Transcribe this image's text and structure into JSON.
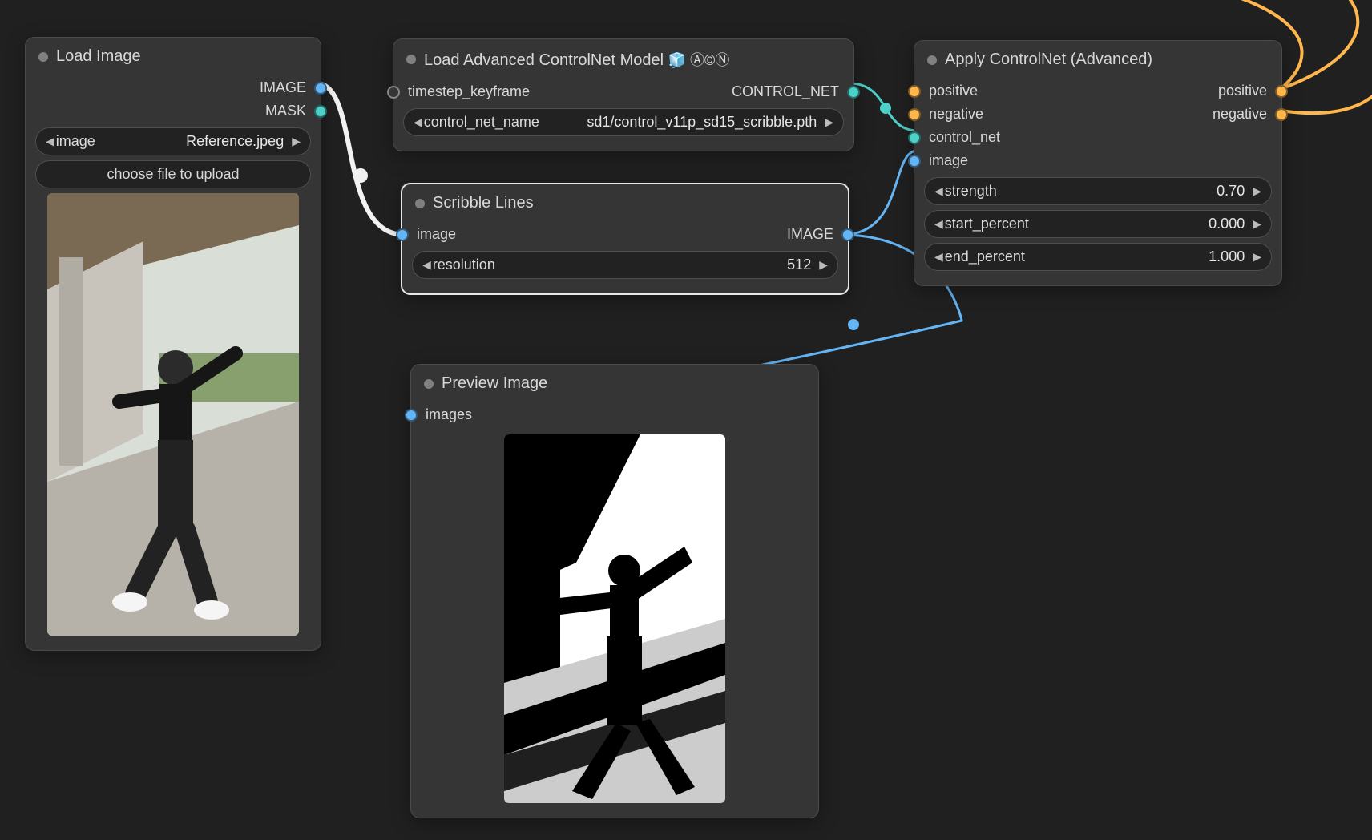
{
  "nodes": {
    "loadImage": {
      "title": "Load Image",
      "outputs": {
        "image": "IMAGE",
        "mask": "MASK"
      },
      "widgets": {
        "image_label": "image",
        "image_value": "Reference.jpeg",
        "choose": "choose file to upload"
      }
    },
    "loadControlNet": {
      "title": "Load Advanced ControlNet Model ",
      "emoji": "🧊 Ⓐ©Ⓝ",
      "inputs": {
        "timestep": "timestep_keyframe"
      },
      "outputs": {
        "control_net": "CONTROL_NET"
      },
      "widgets": {
        "cn_name_label": "control_net_name",
        "cn_name_value": "sd1/control_v11p_sd15_scribble.pth"
      }
    },
    "scribble": {
      "title": "Scribble Lines",
      "inputs": {
        "image": "image"
      },
      "outputs": {
        "image": "IMAGE"
      },
      "widgets": {
        "resolution_label": "resolution",
        "resolution_value": "512"
      }
    },
    "previewImage": {
      "title": "Preview Image",
      "inputs": {
        "images": "images"
      }
    },
    "applyControlNet": {
      "title": "Apply ControlNet (Advanced)",
      "inputs": {
        "positive": "positive",
        "negative": "negative",
        "control_net": "control_net",
        "image": "image"
      },
      "outputs": {
        "positive": "positive",
        "negative": "negative"
      },
      "widgets": {
        "strength_label": "strength",
        "strength_value": "0.70",
        "start_label": "start_percent",
        "start_value": "0.000",
        "end_label": "end_percent",
        "end_value": "1.000"
      }
    }
  },
  "colors": {
    "image_link": "#64b5f6",
    "mask_link": "#4dd0c8",
    "controlnet_link": "#4dd0c8",
    "cond_link": "#ffb74d"
  }
}
